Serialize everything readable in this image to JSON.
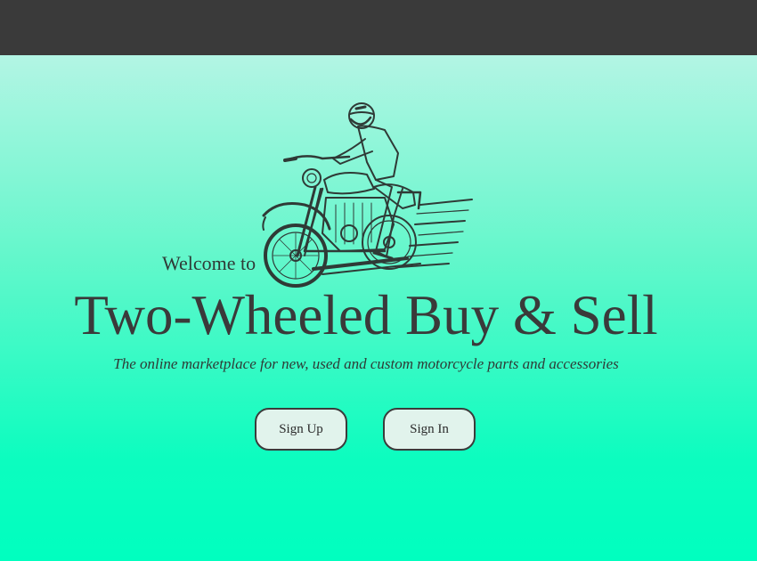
{
  "hero": {
    "illustration_icon": "motorcycle-rider-icon",
    "welcome": "Welcome to",
    "title": "Two-Wheeled Buy & Sell",
    "tagline": "The online marketplace for new, used and custom motorcycle parts and accessories"
  },
  "actions": {
    "sign_up": "Sign Up",
    "sign_in": "Sign In"
  },
  "colors": {
    "topbar": "#3a3a3a",
    "gradient_top": "#b3f5e4",
    "gradient_bottom": "#00ffbf",
    "button_bg": "#e1f3ec",
    "text": "#3a3a3a"
  }
}
